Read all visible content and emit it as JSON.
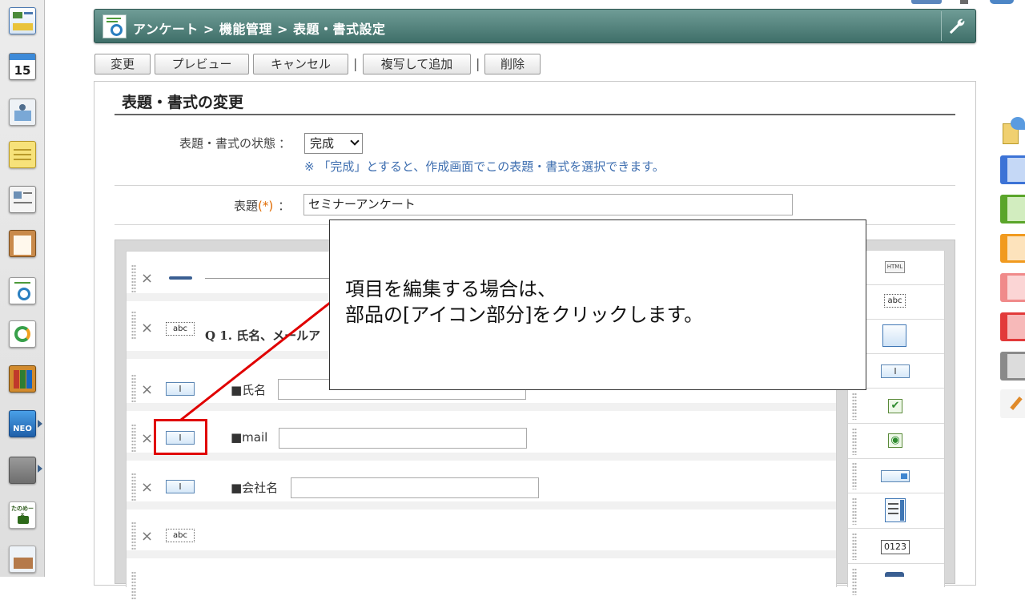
{
  "left_bar": {
    "calendar_day": "15",
    "neo_label": "NEO",
    "tanomeru_label": "たのめーる"
  },
  "header": {
    "breadcrumb": "アンケート > 機能管理 > 表題・書式設定"
  },
  "toolbar": {
    "change_label": "変更",
    "preview_label": "プレビュー",
    "cancel_label": "キャンセル",
    "pipe": "|",
    "copy_add_label": "複写して追加",
    "delete_label": "削除"
  },
  "form": {
    "section_title": "表題・書式の変更",
    "status_label": "表題・書式の状態",
    "colon": "：",
    "status_value": "完成",
    "status_note": "※ 「完成」とすると、作成画面でこの表題・書式を選択できます。",
    "title_label": "表題",
    "required_mark": "(*)",
    "title_value": "セミナーアンケート"
  },
  "editor": {
    "items": [
      {
        "type": "hr"
      },
      {
        "type": "text",
        "icon_label": "abc",
        "text": "Q 1. 氏名、メールア"
      },
      {
        "type": "input",
        "icon_label": "I",
        "label": "■氏名"
      },
      {
        "type": "input",
        "icon_label": "I",
        "label": "■mail"
      },
      {
        "type": "input",
        "icon_label": "I",
        "label": "■会社名"
      },
      {
        "type": "text",
        "icon_label": "abc",
        "text": ""
      }
    ],
    "delete_symbol": "×"
  },
  "palette": {
    "items": [
      {
        "name": "html",
        "label": "HTML"
      },
      {
        "name": "text",
        "label": "abc"
      },
      {
        "name": "textarea",
        "label": ""
      },
      {
        "name": "textbox",
        "label": "I"
      },
      {
        "name": "checkbox",
        "label": "✔"
      },
      {
        "name": "radio",
        "label": "◉"
      },
      {
        "name": "select",
        "label": ""
      },
      {
        "name": "list",
        "label": ""
      },
      {
        "name": "number",
        "label": "0123"
      }
    ]
  },
  "callout": {
    "line1": "項目を編集する場合は、",
    "line2": "部品の[アイコン部分]をクリックします。"
  },
  "colors": {
    "title_bar": "#4f807a",
    "highlight": "#e00000",
    "note": "#3f6fb0",
    "required": "#e06a00"
  }
}
